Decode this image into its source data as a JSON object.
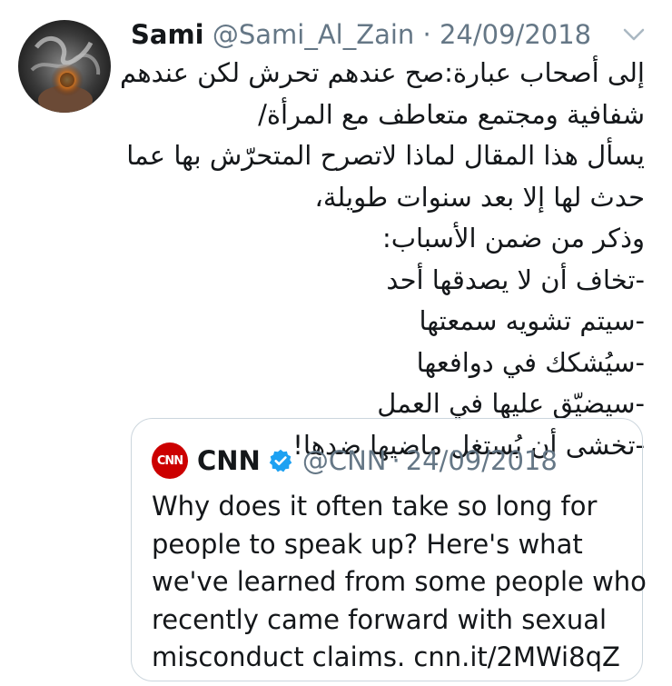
{
  "tweet": {
    "author_name": "Sami",
    "author_handle": "@Sami_Al_Zain",
    "separator": "·",
    "date": "24/09/2018",
    "text_lines": [
      "إلى أصحاب عبارة:صح عندهم تحرش لكن عندهم",
      "شفافية ومجتمع متعاطف مع المرأة/",
      "يسأل هذا المقال لماذا لاتصرح المتحرّش بها عما",
      "حدث لها إلا بعد سنوات طويلة،",
      "وذكر من ضمن الأسباب:",
      "-تخاف أن لا يصدقها أحد",
      "-سيتم تشويه سمعتها",
      "-سيُشكك في دوافعها",
      "-سيضيّق عليها في العمل",
      "-تخشى أن يُستغل ماضيها ضدها!"
    ]
  },
  "quoted": {
    "logo_text": "CNN",
    "author_name": "CNN",
    "author_handle": "@CNN",
    "separator": "·",
    "date": "24/09/2018",
    "text_lines": [
      "Why does it often take so long for",
      "people to speak up? Here's what",
      "we've learned from some people who",
      "recently came forward with sexual",
      "misconduct claims. cnn.it/2MWi8qZ"
    ]
  },
  "icons": {
    "avatar": "avatar-image",
    "menu": "chevron-down-icon",
    "verified": "verified-badge-icon",
    "logo": "cnn-logo"
  },
  "colors": {
    "text": "#14171a",
    "secondary": "#657786",
    "border": "#ccd6dd",
    "verified": "#1da1f2",
    "cnn_red": "#cc0000"
  }
}
